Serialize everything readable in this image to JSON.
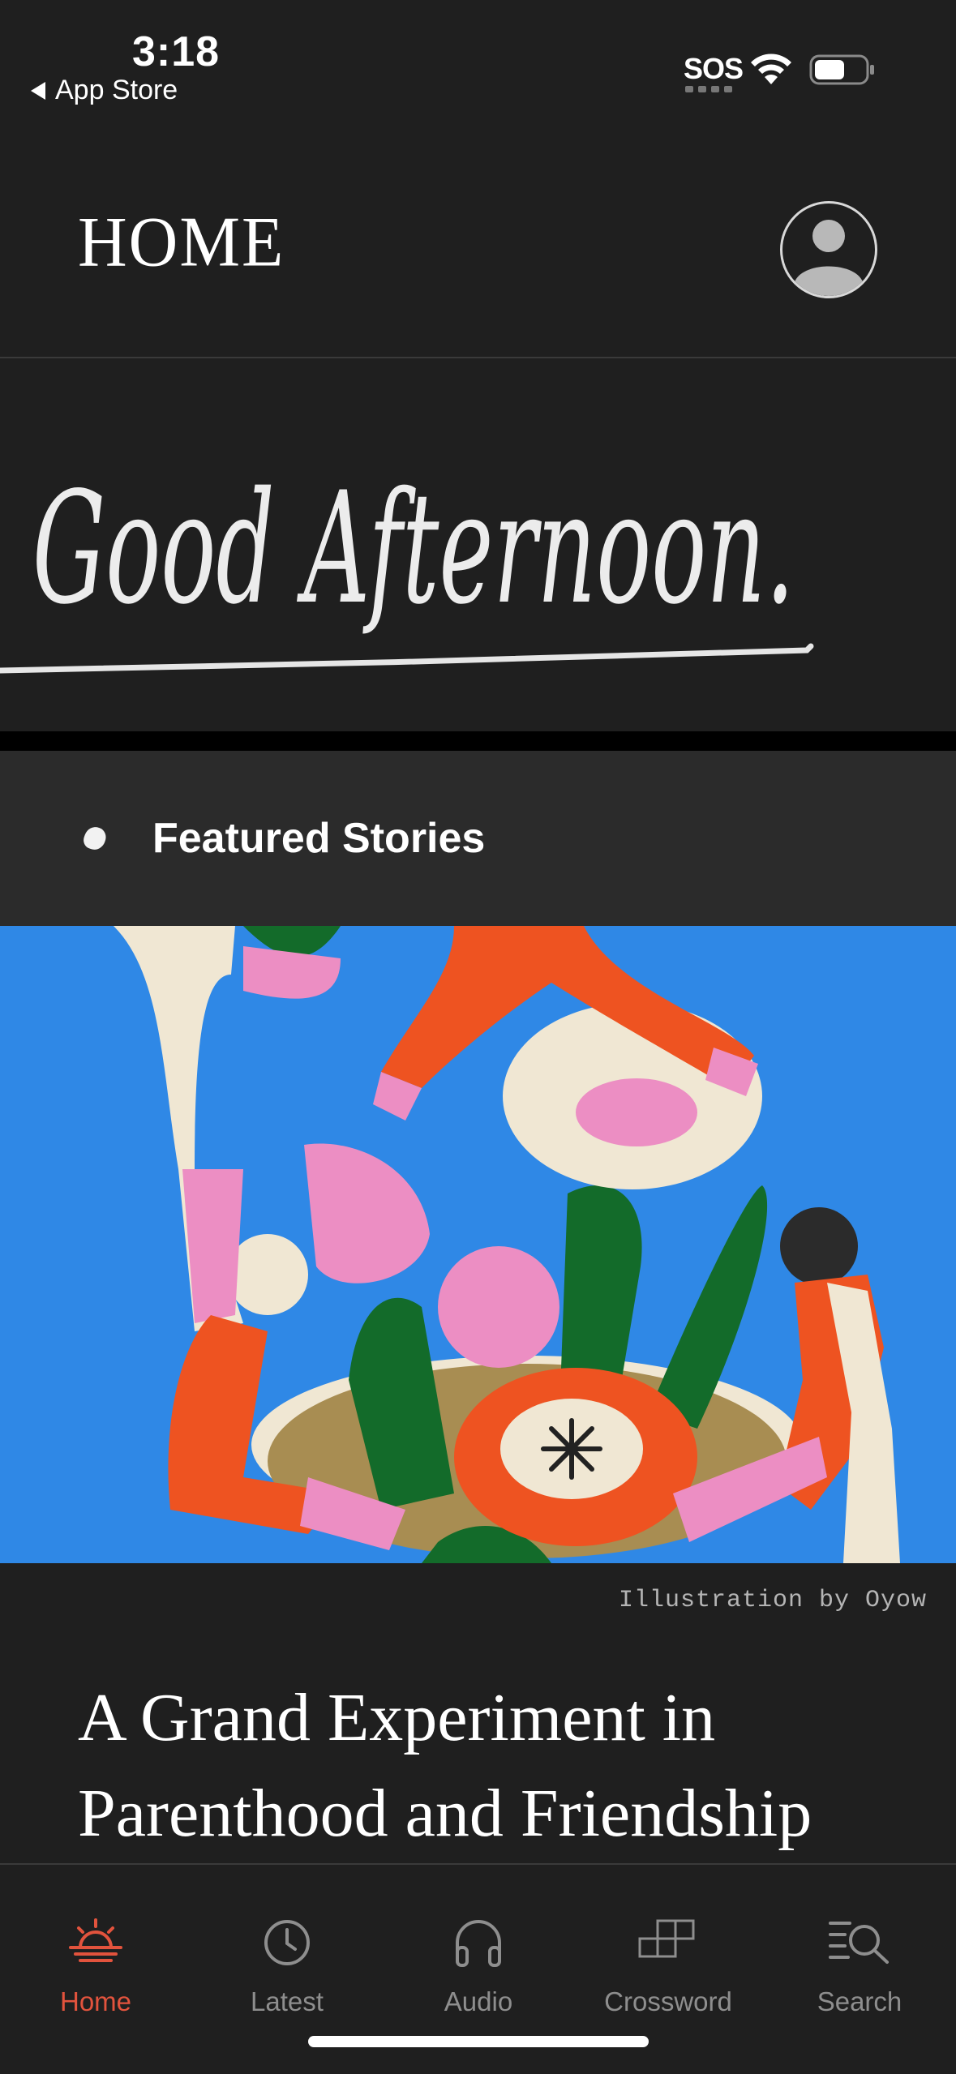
{
  "status_bar": {
    "time": "3:18",
    "back_label": "App Store",
    "sos": "SOS",
    "battery_level": 0.6
  },
  "header": {
    "title": "HOME"
  },
  "greeting": {
    "text": "Good Afternoon."
  },
  "featured": {
    "section_title": "Featured Stories",
    "image_credit": "Illustration by Oyow",
    "headline": "A Grand Experiment in Parenthood and Friendship"
  },
  "tab_bar": {
    "tabs": [
      {
        "label": "Home",
        "icon": "sunrise-icon",
        "active": true
      },
      {
        "label": "Latest",
        "icon": "clock-icon",
        "active": false
      },
      {
        "label": "Audio",
        "icon": "headphones-icon",
        "active": false
      },
      {
        "label": "Crossword",
        "icon": "crossword-grid-icon",
        "active": false
      },
      {
        "label": "Search",
        "icon": "search-list-icon",
        "active": false
      }
    ]
  },
  "colors": {
    "background": "#1f1f1f",
    "section_background": "#2b2b2b",
    "accent": "#e2533d",
    "tab_inactive": "#8e8e8e"
  }
}
